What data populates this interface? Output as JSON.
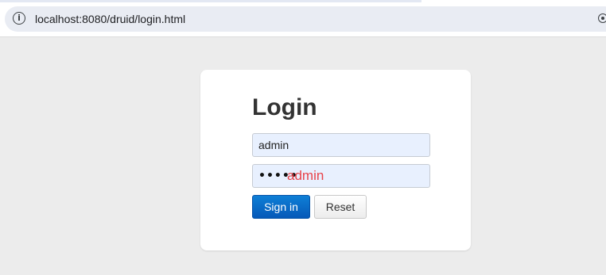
{
  "browser": {
    "url": "localhost:8080/druid/login.html",
    "info_icon": "i",
    "right_icon": "site-settings-icon"
  },
  "login": {
    "title": "Login",
    "username_value": "admin",
    "password_mask": "•••••",
    "password_note": "admin",
    "password_note_color": "#e8434a",
    "signin_label": "Sign in",
    "reset_label": "Reset",
    "primary_color": "#0b6fcf"
  }
}
